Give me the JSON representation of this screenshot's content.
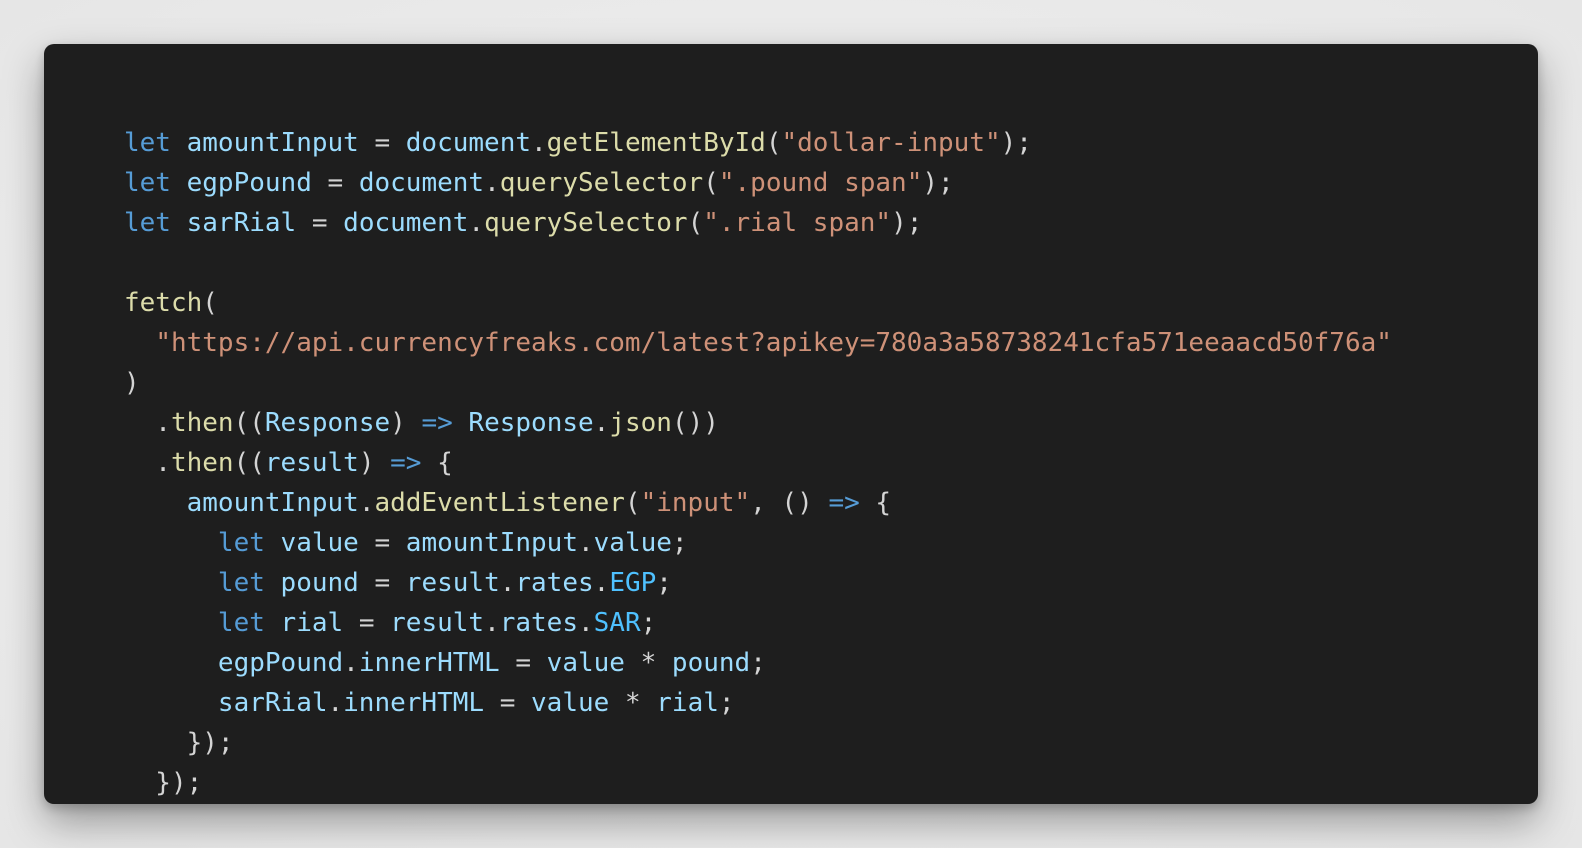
{
  "palette": {
    "kw": "#569cd6",
    "var": "#9cdcfe",
    "fn": "#dcdcaa",
    "str": "#ce9178",
    "punc": "#d4d4d4",
    "const": "#4fc1ff",
    "background": "#1e1e1e"
  },
  "code": {
    "language": "javascript",
    "lines": [
      [
        [
          "kw",
          "let"
        ],
        [
          "punc",
          " "
        ],
        [
          "var",
          "amountInput"
        ],
        [
          "punc",
          " = "
        ],
        [
          "var",
          "document"
        ],
        [
          "punc",
          "."
        ],
        [
          "fn",
          "getElementById"
        ],
        [
          "punc",
          "("
        ],
        [
          "str",
          "\"dollar-input\""
        ],
        [
          "punc",
          ");"
        ]
      ],
      [
        [
          "kw",
          "let"
        ],
        [
          "punc",
          " "
        ],
        [
          "var",
          "egpPound"
        ],
        [
          "punc",
          " = "
        ],
        [
          "var",
          "document"
        ],
        [
          "punc",
          "."
        ],
        [
          "fn",
          "querySelector"
        ],
        [
          "punc",
          "("
        ],
        [
          "str",
          "\".pound span\""
        ],
        [
          "punc",
          ");"
        ]
      ],
      [
        [
          "kw",
          "let"
        ],
        [
          "punc",
          " "
        ],
        [
          "var",
          "sarRial"
        ],
        [
          "punc",
          " = "
        ],
        [
          "var",
          "document"
        ],
        [
          "punc",
          "."
        ],
        [
          "fn",
          "querySelector"
        ],
        [
          "punc",
          "("
        ],
        [
          "str",
          "\".rial span\""
        ],
        [
          "punc",
          ");"
        ]
      ],
      [],
      [
        [
          "fn",
          "fetch"
        ],
        [
          "punc",
          "("
        ]
      ],
      [
        [
          "punc",
          "  "
        ],
        [
          "str",
          "\"https://api.currencyfreaks.com/latest?apikey=780a3a58738241cfa571eeaacd50f76a\""
        ]
      ],
      [
        [
          "punc",
          ")"
        ]
      ],
      [
        [
          "punc",
          "  ."
        ],
        [
          "fn",
          "then"
        ],
        [
          "punc",
          "(("
        ],
        [
          "var",
          "Response"
        ],
        [
          "punc",
          ") "
        ],
        [
          "kw",
          "=>"
        ],
        [
          "punc",
          " "
        ],
        [
          "var",
          "Response"
        ],
        [
          "punc",
          "."
        ],
        [
          "fn",
          "json"
        ],
        [
          "punc",
          "())"
        ]
      ],
      [
        [
          "punc",
          "  ."
        ],
        [
          "fn",
          "then"
        ],
        [
          "punc",
          "(("
        ],
        [
          "var",
          "result"
        ],
        [
          "punc",
          ") "
        ],
        [
          "kw",
          "=>"
        ],
        [
          "punc",
          " {"
        ]
      ],
      [
        [
          "punc",
          "    "
        ],
        [
          "var",
          "amountInput"
        ],
        [
          "punc",
          "."
        ],
        [
          "fn",
          "addEventListener"
        ],
        [
          "punc",
          "("
        ],
        [
          "str",
          "\"input\""
        ],
        [
          "punc",
          ", () "
        ],
        [
          "kw",
          "=>"
        ],
        [
          "punc",
          " {"
        ]
      ],
      [
        [
          "punc",
          "      "
        ],
        [
          "kw",
          "let"
        ],
        [
          "punc",
          " "
        ],
        [
          "var",
          "value"
        ],
        [
          "punc",
          " = "
        ],
        [
          "var",
          "amountInput"
        ],
        [
          "punc",
          "."
        ],
        [
          "var",
          "value"
        ],
        [
          "punc",
          ";"
        ]
      ],
      [
        [
          "punc",
          "      "
        ],
        [
          "kw",
          "let"
        ],
        [
          "punc",
          " "
        ],
        [
          "var",
          "pound"
        ],
        [
          "punc",
          " = "
        ],
        [
          "var",
          "result"
        ],
        [
          "punc",
          "."
        ],
        [
          "var",
          "rates"
        ],
        [
          "punc",
          "."
        ],
        [
          "const",
          "EGP"
        ],
        [
          "punc",
          ";"
        ]
      ],
      [
        [
          "punc",
          "      "
        ],
        [
          "kw",
          "let"
        ],
        [
          "punc",
          " "
        ],
        [
          "var",
          "rial"
        ],
        [
          "punc",
          " = "
        ],
        [
          "var",
          "result"
        ],
        [
          "punc",
          "."
        ],
        [
          "var",
          "rates"
        ],
        [
          "punc",
          "."
        ],
        [
          "const",
          "SAR"
        ],
        [
          "punc",
          ";"
        ]
      ],
      [
        [
          "punc",
          "      "
        ],
        [
          "var",
          "egpPound"
        ],
        [
          "punc",
          "."
        ],
        [
          "var",
          "innerHTML"
        ],
        [
          "punc",
          " = "
        ],
        [
          "var",
          "value"
        ],
        [
          "punc",
          " * "
        ],
        [
          "var",
          "pound"
        ],
        [
          "punc",
          ";"
        ]
      ],
      [
        [
          "punc",
          "      "
        ],
        [
          "var",
          "sarRial"
        ],
        [
          "punc",
          "."
        ],
        [
          "var",
          "innerHTML"
        ],
        [
          "punc",
          " = "
        ],
        [
          "var",
          "value"
        ],
        [
          "punc",
          " * "
        ],
        [
          "var",
          "rial"
        ],
        [
          "punc",
          ";"
        ]
      ],
      [
        [
          "punc",
          "    });"
        ]
      ],
      [
        [
          "punc",
          "  });"
        ]
      ]
    ]
  }
}
